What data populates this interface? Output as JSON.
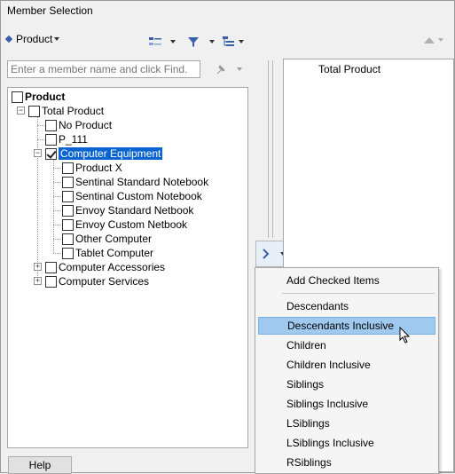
{
  "window": {
    "title": "Member Selection"
  },
  "toolbar": {
    "dimension_label": "Product",
    "icons": [
      "diamond-icon",
      "member-icon",
      "filter-icon",
      "hierarchy-icon",
      "pin-icon"
    ],
    "right_icons": [
      "up-arrow-icon"
    ]
  },
  "search": {
    "placeholder": "Enter a member name and click Find."
  },
  "tree": {
    "root": "Product",
    "items": [
      {
        "label": "Total Product"
      },
      {
        "label": "No Product"
      },
      {
        "label": "P_111"
      },
      {
        "label": "Computer Equipment",
        "checked": true,
        "selected": true
      },
      {
        "label": "Product X"
      },
      {
        "label": "Sentinal Standard Notebook"
      },
      {
        "label": "Sentinal Custom Notebook"
      },
      {
        "label": "Envoy Standard Netbook"
      },
      {
        "label": "Envoy Custom Netbook"
      },
      {
        "label": "Other Computer"
      },
      {
        "label": "Tablet Computer"
      },
      {
        "label": "Computer Accessories"
      },
      {
        "label": "Computer Services"
      }
    ]
  },
  "selected_panel": {
    "items": [
      "Total Product"
    ]
  },
  "menu": {
    "items": [
      "Add Checked Items",
      "Descendants",
      "Descendants Inclusive",
      "Children",
      "Children Inclusive",
      "Siblings",
      "Siblings Inclusive",
      "LSiblings",
      "LSiblings Inclusive",
      "RSiblings"
    ],
    "hovered": "Descendants Inclusive"
  },
  "buttons": {
    "help": "Help"
  },
  "colors": {
    "selection": "#0a64cf",
    "menu_hover": "#9fc9ef",
    "icon_blue": "#3b5fa8"
  }
}
